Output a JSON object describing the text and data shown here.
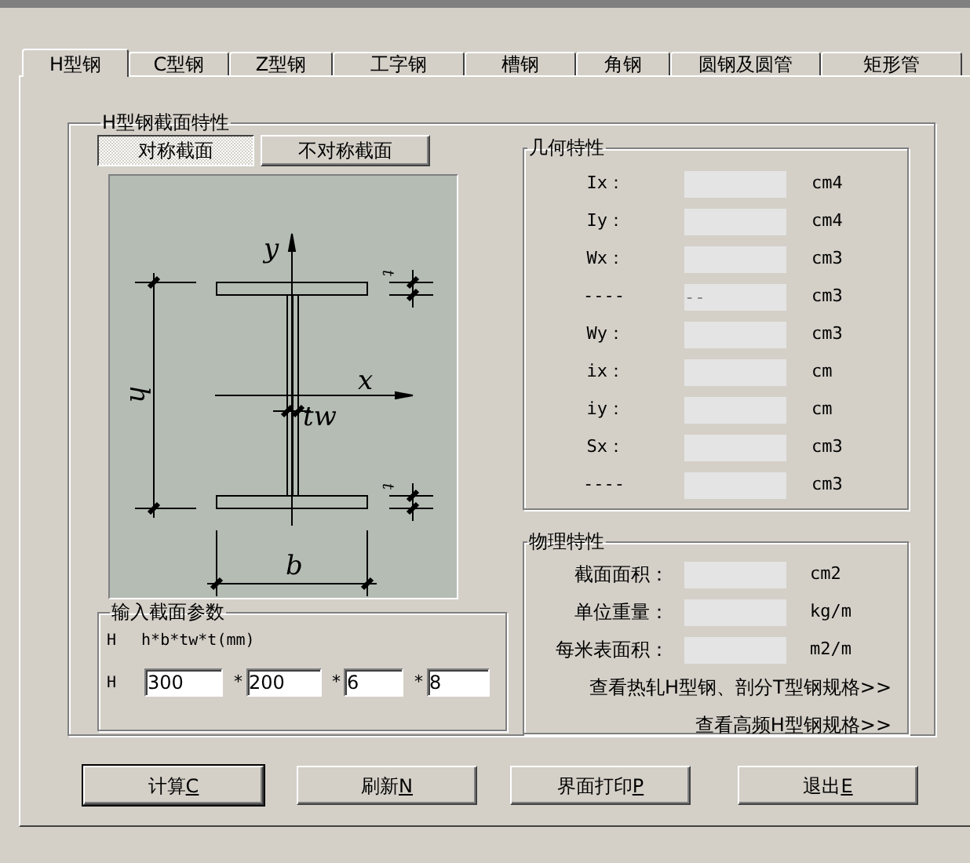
{
  "tabs": [
    {
      "label": "H型钢",
      "selected": true
    },
    {
      "label": "C型钢",
      "selected": false
    },
    {
      "label": "Z型钢",
      "selected": false
    },
    {
      "label": "工字钢",
      "selected": false
    },
    {
      "label": "槽钢",
      "selected": false
    },
    {
      "label": "角钢",
      "selected": false
    },
    {
      "label": "圆钢及圆管",
      "selected": false
    },
    {
      "label": "矩形管",
      "selected": false
    }
  ],
  "section_group": {
    "title": "H型钢截面特性",
    "modes": [
      {
        "label": "对称截面",
        "selected": true
      },
      {
        "label": "不对称截面",
        "selected": false
      }
    ]
  },
  "diagram": {
    "y_axis": "y",
    "x_axis": "x",
    "web": "tw",
    "height": "h",
    "width": "b",
    "flange_top": "t",
    "flange_bottom": "t"
  },
  "input_group": {
    "title": "输入截面参数",
    "type": "H",
    "formula": "h*b*tw*t(mm)",
    "row_label": "H",
    "params": [
      {
        "value": "300"
      },
      {
        "separator": "*",
        "value": "200"
      },
      {
        "separator": "*",
        "value": "6"
      },
      {
        "separator": "*",
        "value": "8"
      }
    ]
  },
  "geometry": {
    "title": "几何特性",
    "rows": [
      {
        "label": "Ix：",
        "unit": "cm4"
      },
      {
        "label": "Iy：",
        "unit": "cm4"
      },
      {
        "label": "Wx：",
        "unit": "cm3"
      },
      {
        "label": "----",
        "value": "--",
        "unit": "cm3"
      },
      {
        "label": "Wy：",
        "unit": "cm3"
      },
      {
        "label": "ix：",
        "unit": "cm"
      },
      {
        "label": "iy：",
        "unit": "cm"
      },
      {
        "label": "Sx：",
        "unit": "cm3"
      },
      {
        "label": "----",
        "unit": "cm3"
      }
    ]
  },
  "physical": {
    "title": "物理特性",
    "rows": [
      {
        "label": "截面面积：",
        "unit": "cm2"
      },
      {
        "label": "单位重量：",
        "unit": "kg/m"
      },
      {
        "label": "每米表面积：",
        "unit": "m2/m"
      }
    ],
    "links": [
      "查看热轧H型钢、剖分T型钢规格>>",
      "查看高频H型钢规格>>"
    ]
  },
  "buttons": [
    {
      "label": "计算",
      "hotkey": "C",
      "default": true
    },
    {
      "label": "刷新",
      "hotkey": "N",
      "default": false
    },
    {
      "label": "界面打印",
      "hotkey": "P",
      "default": false
    },
    {
      "label": "退出",
      "hotkey": "E",
      "default": false
    }
  ]
}
